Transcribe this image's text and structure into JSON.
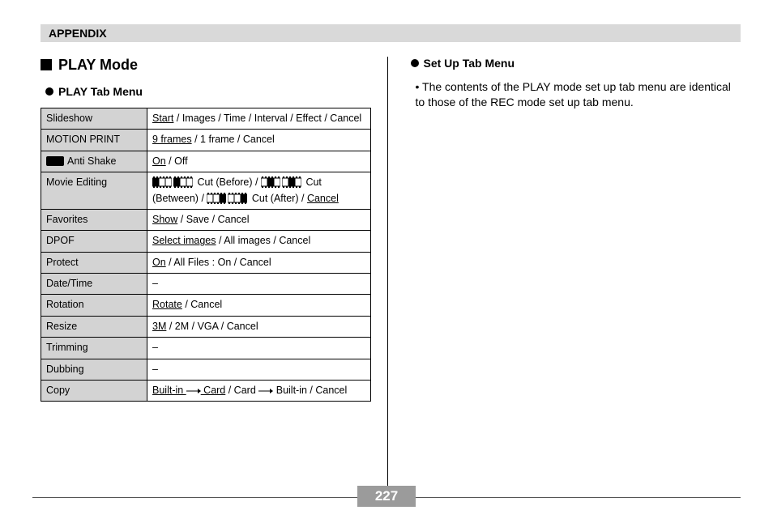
{
  "header": {
    "appendix": "APPENDIX"
  },
  "left": {
    "mode_heading": "PLAY Mode",
    "sub_heading": "PLAY Tab Menu",
    "rows": [
      {
        "label": "Slideshow",
        "kind": "options",
        "parts": [
          {
            "t": "Start",
            "u": true
          },
          {
            "t": " / Images / Time / Interval / Effect / Cancel"
          }
        ]
      },
      {
        "label": "MOTION PRINT",
        "kind": "options",
        "parts": [
          {
            "t": "9 frames",
            "u": true
          },
          {
            "t": " / 1 frame / Cancel"
          }
        ]
      },
      {
        "label_prefix_icon": "anti-shake",
        "label": "Anti Shake",
        "kind": "options",
        "parts": [
          {
            "t": "On",
            "u": true
          },
          {
            "t": " / Off"
          }
        ]
      },
      {
        "label": "Movie Editing",
        "kind": "movie-edit"
      },
      {
        "label": "Favorites",
        "kind": "options",
        "parts": [
          {
            "t": "Show",
            "u": true
          },
          {
            "t": " / Save / Cancel"
          }
        ]
      },
      {
        "label": "DPOF",
        "kind": "options",
        "parts": [
          {
            "t": "Select images",
            "u": true
          },
          {
            "t": " / All images / Cancel"
          }
        ]
      },
      {
        "label": "Protect",
        "kind": "options",
        "parts": [
          {
            "t": "On",
            "u": true
          },
          {
            "t": " / All Files : On / Cancel"
          }
        ]
      },
      {
        "label": "Date/Time",
        "kind": "dash"
      },
      {
        "label": "Rotation",
        "kind": "options",
        "parts": [
          {
            "t": "Rotate",
            "u": true
          },
          {
            "t": " / Cancel"
          }
        ]
      },
      {
        "label": "Resize",
        "kind": "options",
        "parts": [
          {
            "t": "3M",
            "u": true
          },
          {
            "t": " / 2M / VGA / Cancel"
          }
        ]
      },
      {
        "label": "Trimming",
        "kind": "dash"
      },
      {
        "label": "Dubbing",
        "kind": "dash"
      },
      {
        "label": "Copy",
        "kind": "copy"
      }
    ],
    "movie_edit": {
      "cut_before": "Cut (Before)",
      "cut_between": "Cut (Between)",
      "cut_after": "Cut (After)",
      "cancel": "Cancel"
    },
    "copy": {
      "builtin": "Built-in",
      "card": "Card",
      "cancel": "Cancel"
    },
    "dash": "–"
  },
  "right": {
    "sub_heading": "Set Up Tab Menu",
    "note_bullet": "•",
    "note": "The contents of the PLAY mode set up tab menu are identical to those of the REC mode set up tab menu."
  },
  "footer": {
    "page": "227"
  }
}
